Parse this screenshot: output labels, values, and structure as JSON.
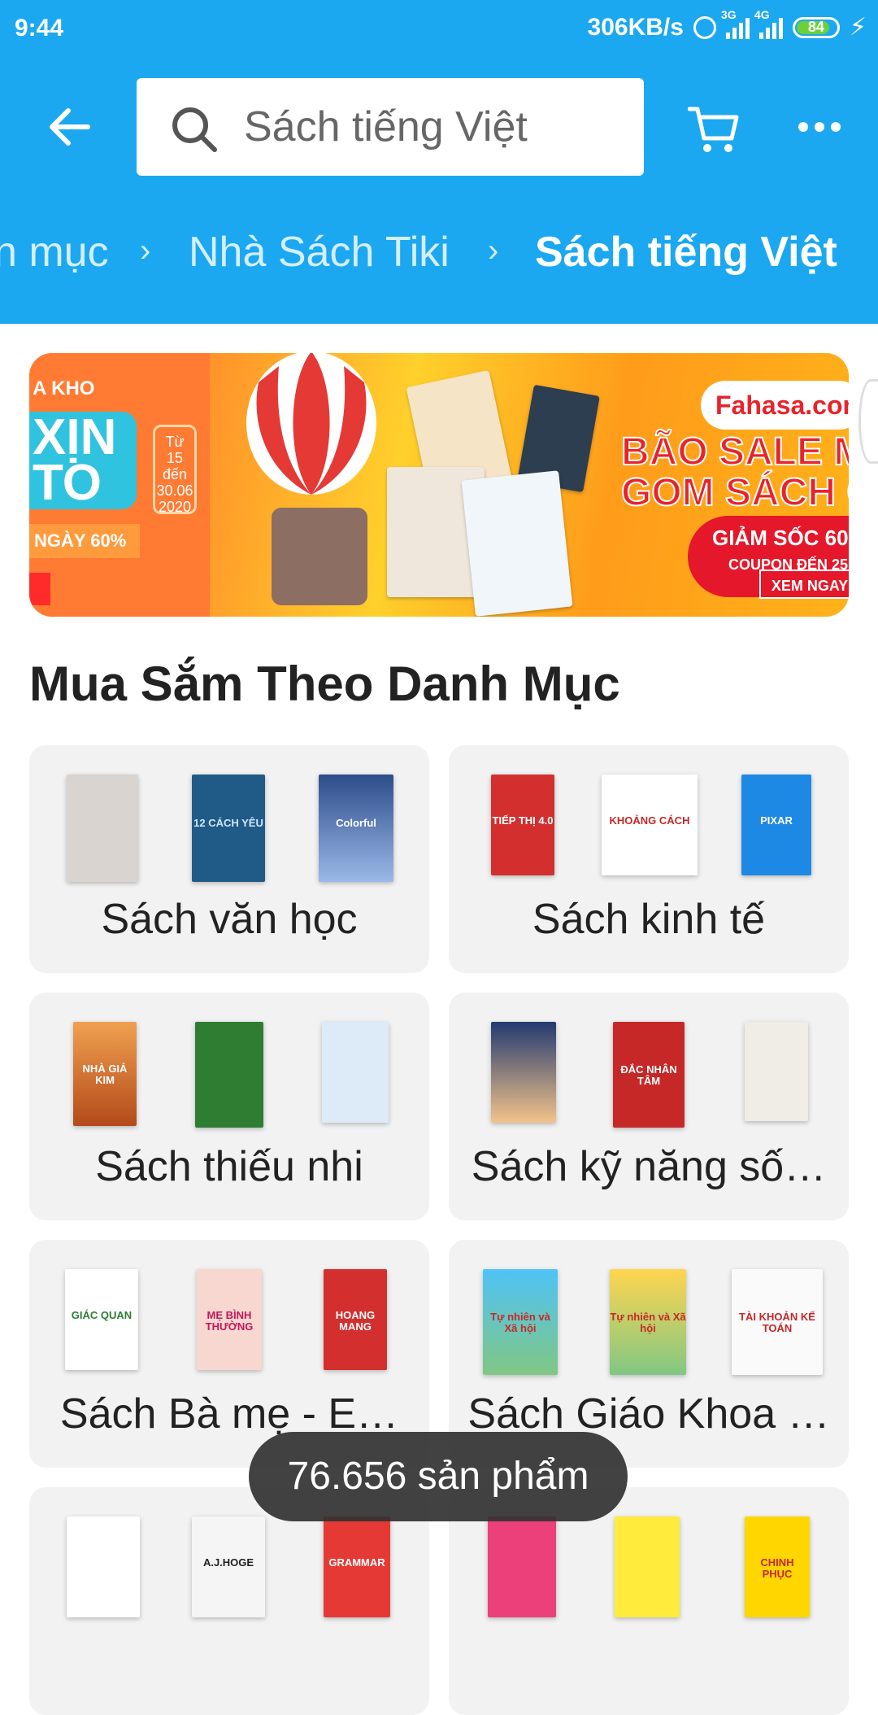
{
  "status_bar": {
    "time": "9:44",
    "network_speed": "306KB/s",
    "signal_1_label": "3G",
    "signal_2_label": "4G",
    "battery": "84"
  },
  "header": {
    "search_placeholder": "Sách tiếng Việt",
    "breadcrumb": [
      "n mục",
      "Nhà Sách Tiki",
      "Sách tiếng Việt"
    ]
  },
  "banner": {
    "left_kho": "A KHO",
    "left_xin": "XỊN TO",
    "left_dates": "Từ 15 đến 30.06 2020",
    "left_percent": "NGÀY 60%",
    "brand": "Fahasa.com",
    "headline_1": "BÃO SALE M",
    "headline_2": "GOM SÁCH C",
    "discount": "GIẢM SỐC 60",
    "coupon": "COUPON ĐẾN 25",
    "cta": "XEM NGAY"
  },
  "section_title": "Mua Sắm Theo Danh Mục",
  "categories": [
    {
      "label": "Sách văn học",
      "covers": [
        "",
        "12 CÁCH YÊU",
        "Colorful"
      ]
    },
    {
      "label": "Sách kinh tế",
      "covers": [
        "TIẾP THỊ 4.0",
        "KHOẢNG CÁCH",
        "PIXAR"
      ]
    },
    {
      "label": "Sách thiếu nhi",
      "covers": [
        "NHÀ GIẢ KIM",
        "",
        ""
      ]
    },
    {
      "label": "Sách kỹ năng số…",
      "covers": [
        "",
        "ĐẮC NHÂN TÂM",
        ""
      ]
    },
    {
      "label": "Sách Bà mẹ - E…",
      "covers": [
        "GIÁC QUAN",
        "MẸ BÌNH THƯỜNG",
        "HOANG MANG"
      ]
    },
    {
      "label": "Sách Giáo Khoa …",
      "covers": [
        "Tự nhiên và Xã hội",
        "Tự nhiên và Xã hội",
        "TÀI KHOẢN KẾ TOÁN"
      ]
    },
    {
      "label": "",
      "covers": [
        "",
        "A.J.HOGE",
        "GRAMMAR"
      ]
    },
    {
      "label": "",
      "covers": [
        "",
        "",
        "CHINH PHỤC"
      ]
    }
  ],
  "toast": "76.656 sản phẩm",
  "colors": {
    "header": "#1ba8f0",
    "card_bg": "#f2f2f2",
    "toast": "#323232"
  }
}
